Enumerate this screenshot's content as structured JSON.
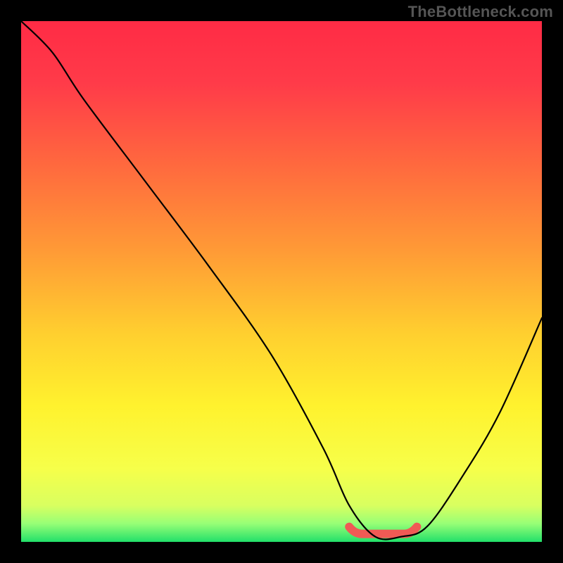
{
  "watermark": "TheBottleneck.com",
  "chart_data": {
    "type": "line",
    "title": "",
    "xlabel": "",
    "ylabel": "",
    "xlim": [
      0,
      100
    ],
    "ylim": [
      0,
      100
    ],
    "grid": false,
    "legend": false,
    "series": [
      {
        "name": "bottleneck-curve",
        "x": [
          0,
          6,
          12,
          24,
          36,
          48,
          58,
          63,
          68,
          73,
          78,
          85,
          92,
          100
        ],
        "y": [
          100,
          94,
          85,
          69,
          53,
          36,
          18,
          7,
          1,
          1,
          3,
          13,
          25,
          43
        ]
      }
    ],
    "annotations": [
      {
        "name": "trough-marker",
        "x_range": [
          63,
          76
        ],
        "y": 1
      }
    ],
    "gradient_stops": [
      {
        "pos": 0.0,
        "color": "#ff2b45"
      },
      {
        "pos": 0.12,
        "color": "#ff3b49"
      },
      {
        "pos": 0.28,
        "color": "#ff6a3e"
      },
      {
        "pos": 0.44,
        "color": "#ff9a36"
      },
      {
        "pos": 0.6,
        "color": "#ffcf2f"
      },
      {
        "pos": 0.74,
        "color": "#fff22e"
      },
      {
        "pos": 0.86,
        "color": "#f6ff4a"
      },
      {
        "pos": 0.93,
        "color": "#d9ff60"
      },
      {
        "pos": 0.965,
        "color": "#97ff76"
      },
      {
        "pos": 1.0,
        "color": "#22e06a"
      }
    ]
  }
}
